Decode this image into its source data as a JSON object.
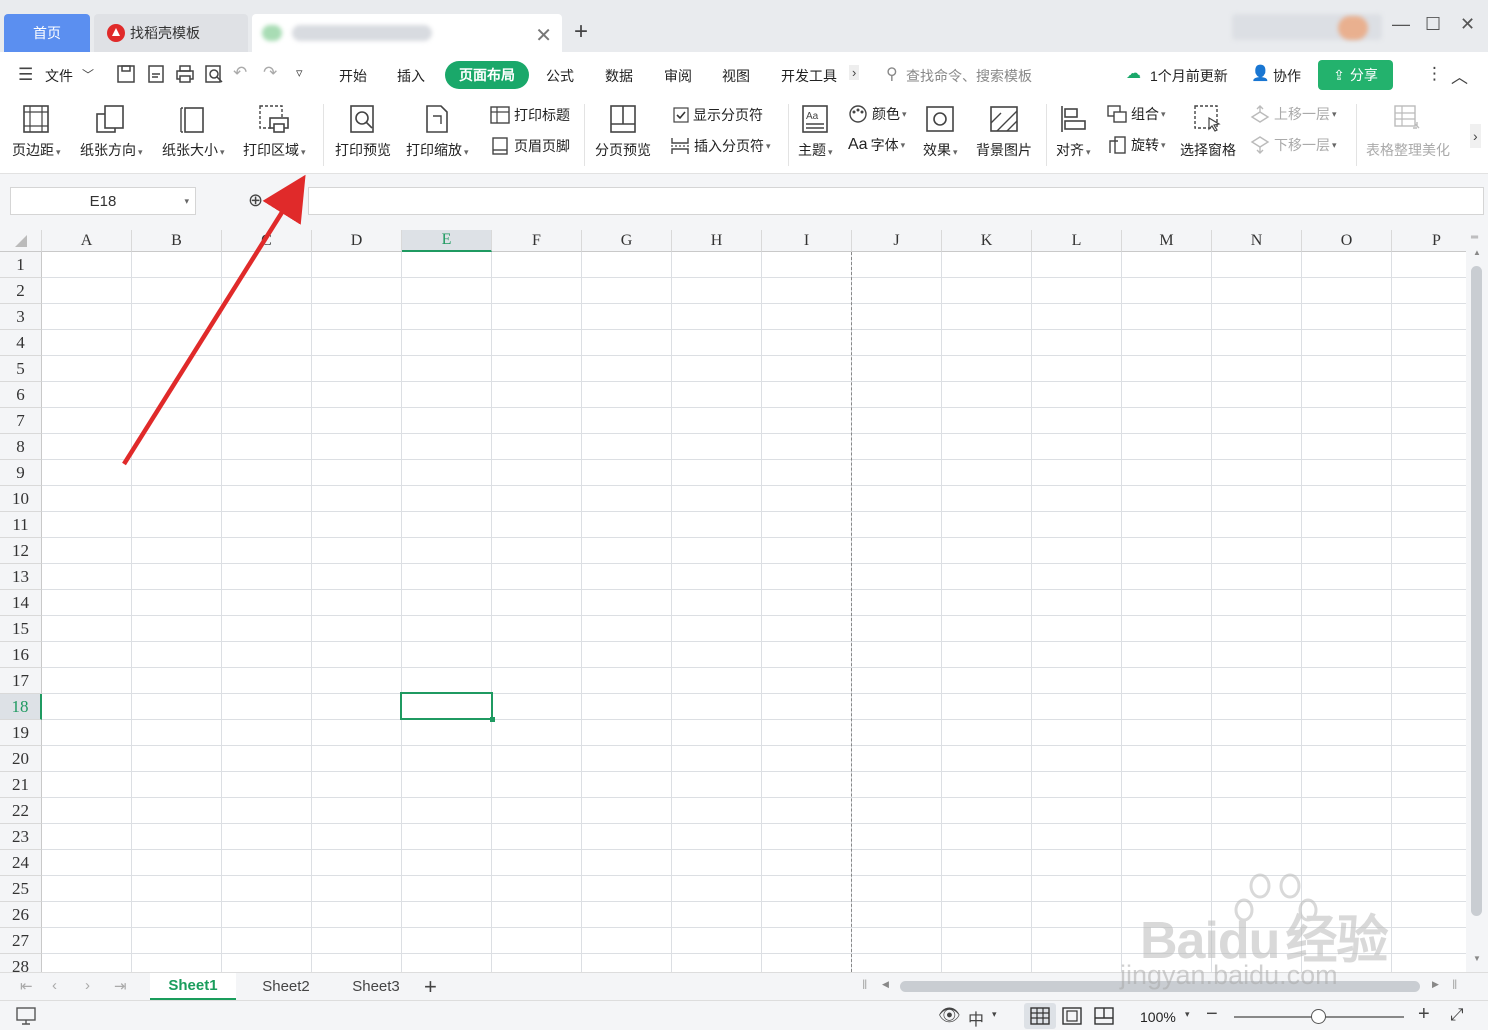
{
  "tabs": {
    "home": "首页",
    "template": "找稻壳模板",
    "new_tab": "+"
  },
  "menu": {
    "file": "文件",
    "items": [
      "开始",
      "插入",
      "页面布局",
      "公式",
      "数据",
      "审阅",
      "视图",
      "开发工具"
    ],
    "search_placeholder": "查找命令、搜索模板",
    "update": "1个月前更新",
    "collab": "协作",
    "share": "分享"
  },
  "ribbon": {
    "margins": "页边距",
    "orientation": "纸张方向",
    "size": "纸张大小",
    "print_area": "打印区域",
    "print_preview": "打印预览",
    "print_scale": "打印缩放",
    "print_titles": "打印标题",
    "header_footer": "页眉页脚",
    "page_break_preview": "分页预览",
    "show_page_breaks": "显示分页符",
    "insert_page_break": "插入分页符",
    "theme": "主题",
    "colors": "颜色",
    "fonts": "字体",
    "effects": "效果",
    "background": "背景图片",
    "align": "对齐",
    "group": "组合",
    "rotate": "旋转",
    "selection_pane": "选择窗格",
    "bring_forward": "上移一层",
    "send_backward": "下移一层",
    "table_beautify": "表格整理美化"
  },
  "formula_bar": {
    "name_box": "E18",
    "fx": "fx",
    "value": ""
  },
  "grid": {
    "columns": [
      "A",
      "B",
      "C",
      "D",
      "E",
      "F",
      "G",
      "H",
      "I",
      "J",
      "K",
      "L",
      "M",
      "N",
      "O",
      "P"
    ],
    "rows": [
      "1",
      "2",
      "3",
      "4",
      "5",
      "6",
      "7",
      "8",
      "9",
      "10",
      "11",
      "12",
      "13",
      "14",
      "15",
      "16",
      "17",
      "18",
      "19",
      "20",
      "21",
      "22",
      "23",
      "24",
      "25",
      "26",
      "27",
      "28"
    ],
    "active_column": "E",
    "active_row": "18"
  },
  "sheets": [
    "Sheet1",
    "Sheet2",
    "Sheet3"
  ],
  "active_sheet": "Sheet1",
  "status": {
    "zoom": "100%"
  },
  "watermark": {
    "brand": "Bai",
    "brand2": "du",
    "brand3": "经验",
    "url": "jingyan.baidu.com"
  },
  "colors": {
    "accent": "#1aa86a",
    "home_tab": "#5b8ff0",
    "arrow": "#e02a2a"
  }
}
